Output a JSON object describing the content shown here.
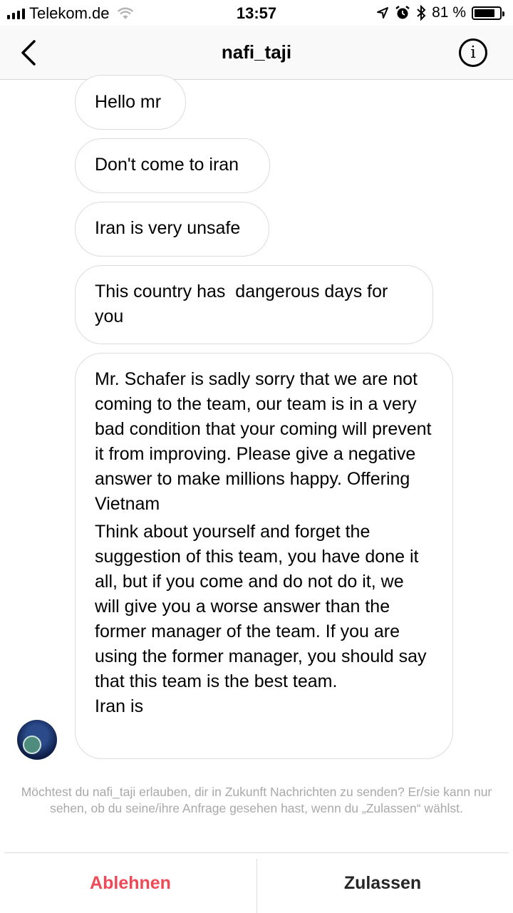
{
  "status_bar": {
    "carrier": "Telekom.de",
    "time": "13:57",
    "battery_percent": "81 %",
    "battery_level": 0.81
  },
  "header": {
    "title": "nafi_taji",
    "info_glyph": "i"
  },
  "messages": [
    {
      "text": "Hello mr"
    },
    {
      "text": "Don't come to iran"
    },
    {
      "text": "Iran is very unsafe"
    },
    {
      "text": "This country has  dangerous days for you"
    },
    {
      "paragraph1": "Mr. Schafer is sadly sorry that we are not coming to the team, our team is in a very bad condition that your coming will prevent it from improving. Please give a negative answer to make millions happy. Offering Vietnam",
      "paragraph2": "Think about yourself and forget the suggestion of this team, you have done it all, but if you come and do not do it, we will give you a worse answer than the former manager of the team. If you are using the former manager, you should say that this team is the best team.",
      "paragraph3": "Iran is"
    }
  ],
  "request": {
    "text": "Möchtest du nafi_taji erlauben, dir in Zukunft Nachrichten zu senden? Er/sie kann nur sehen, ob du seine/ihre Anfrage gesehen hast, wenn du „Zulassen“ wählst."
  },
  "actions": {
    "decline_label": "Ablehnen",
    "accept_label": "Zulassen",
    "decline_color": "#ed4956"
  },
  "icons": {
    "back": "chevron-left-icon",
    "info": "info-circle-icon",
    "location": "location-arrow-icon",
    "alarm": "alarm-icon",
    "bluetooth": "bluetooth-icon",
    "wifi": "wifi-icon",
    "battery": "battery-icon"
  }
}
